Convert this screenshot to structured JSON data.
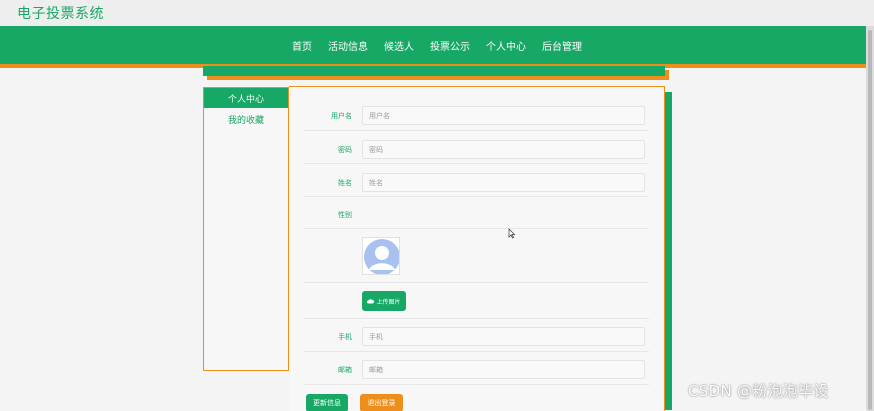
{
  "app": {
    "title": "电子投票系统"
  },
  "nav": {
    "items": [
      {
        "label": "首页"
      },
      {
        "label": "活动信息"
      },
      {
        "label": "候选人"
      },
      {
        "label": "投票公示"
      },
      {
        "label": "个人中心"
      },
      {
        "label": "后台管理"
      }
    ]
  },
  "sidebar": {
    "items": [
      {
        "label": "个人中心",
        "active": true
      },
      {
        "label": "我的收藏",
        "active": false
      }
    ]
  },
  "form": {
    "username": {
      "label": "用户名",
      "placeholder": "用户名"
    },
    "password": {
      "label": "密码",
      "placeholder": "密码"
    },
    "name": {
      "label": "姓名",
      "placeholder": "姓名"
    },
    "gender": {
      "label": "性别"
    },
    "upload": {
      "label": "上传图片"
    },
    "phone": {
      "label": "手机",
      "placeholder": "手机"
    },
    "email": {
      "label": "邮箱",
      "placeholder": "邮箱"
    }
  },
  "actions": {
    "update_label": "更新信息",
    "logout_label": "退出登录"
  },
  "watermark": "CSDN @粉泡泡毕设",
  "colors": {
    "primary": "#17a866",
    "accent": "#ef8f1b"
  },
  "icons": [
    "cloud-upload-icon",
    "avatar-placeholder-icon",
    "mouse-cursor-icon"
  ]
}
